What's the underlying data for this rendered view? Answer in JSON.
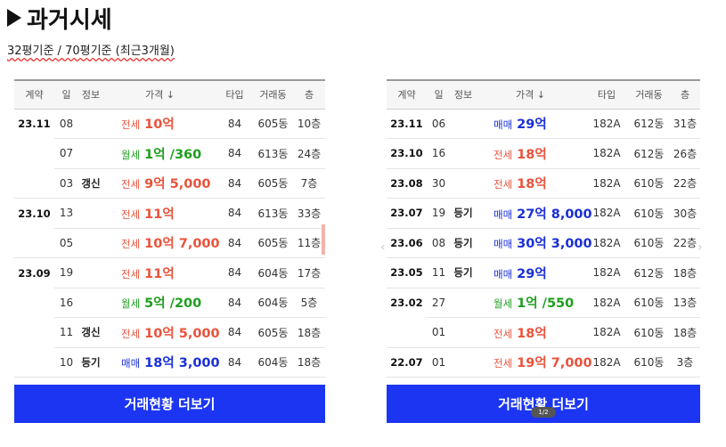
{
  "title": "과거시세",
  "subtitle": "32평기준 / 70평기준 (최근3개월)",
  "headers": [
    "계약",
    "일",
    "정보",
    "가격 ↓",
    "타입",
    "거래동",
    "층"
  ],
  "colors": {
    "jeonse": "#e8533c",
    "wolse": "#1e9e1e",
    "maemae": "#1a2fd6",
    "button": "#1b35f2"
  },
  "left": {
    "rows": [
      {
        "contract": "23.11",
        "day": "08",
        "info": "",
        "kind": "전세",
        "amount": "10억",
        "type": "84",
        "dong": "605동",
        "floor": "10층"
      },
      {
        "contract": "",
        "day": "07",
        "info": "",
        "kind": "월세",
        "amount": "1억 /360",
        "type": "84",
        "dong": "613동",
        "floor": "24층"
      },
      {
        "contract": "",
        "day": "03",
        "info": "갱신",
        "kind": "전세",
        "amount": "9억 5,000",
        "type": "84",
        "dong": "605동",
        "floor": "7층"
      },
      {
        "contract": "23.10",
        "day": "13",
        "info": "",
        "kind": "전세",
        "amount": "11억",
        "type": "84",
        "dong": "613동",
        "floor": "33층"
      },
      {
        "contract": "",
        "day": "05",
        "info": "",
        "kind": "전세",
        "amount": "10억 7,000",
        "type": "84",
        "dong": "605동",
        "floor": "11층"
      },
      {
        "contract": "23.09",
        "day": "19",
        "info": "",
        "kind": "전세",
        "amount": "11억",
        "type": "84",
        "dong": "604동",
        "floor": "17층"
      },
      {
        "contract": "",
        "day": "16",
        "info": "",
        "kind": "월세",
        "amount": "5억 /200",
        "type": "84",
        "dong": "604동",
        "floor": "5층"
      },
      {
        "contract": "",
        "day": "11",
        "info": "갱신",
        "kind": "전세",
        "amount": "10억 5,000",
        "type": "84",
        "dong": "605동",
        "floor": "18층"
      },
      {
        "contract": "",
        "day": "10",
        "info": "등기",
        "kind": "매매",
        "amount": "18억 3,000",
        "type": "84",
        "dong": "604동",
        "floor": "18층"
      }
    ],
    "button": "거래현황 더보기"
  },
  "right": {
    "rows": [
      {
        "contract": "23.11",
        "day": "06",
        "info": "",
        "kind": "매매",
        "amount": "29억",
        "type": "182A",
        "dong": "612동",
        "floor": "31층"
      },
      {
        "contract": "23.10",
        "day": "16",
        "info": "",
        "kind": "전세",
        "amount": "18억",
        "type": "182A",
        "dong": "612동",
        "floor": "26층"
      },
      {
        "contract": "23.08",
        "day": "30",
        "info": "",
        "kind": "전세",
        "amount": "18억",
        "type": "182A",
        "dong": "610동",
        "floor": "22층"
      },
      {
        "contract": "23.07",
        "day": "19",
        "info": "등기",
        "kind": "매매",
        "amount": "27억 8,000",
        "type": "182A",
        "dong": "610동",
        "floor": "30층"
      },
      {
        "contract": "23.06",
        "day": "08",
        "info": "등기",
        "kind": "매매",
        "amount": "30억 3,000",
        "type": "182A",
        "dong": "610동",
        "floor": "22층"
      },
      {
        "contract": "23.05",
        "day": "11",
        "info": "등기",
        "kind": "매매",
        "amount": "29억",
        "type": "182A",
        "dong": "612동",
        "floor": "18층"
      },
      {
        "contract": "23.02",
        "day": "27",
        "info": "",
        "kind": "월세",
        "amount": "1억 /550",
        "type": "182A",
        "dong": "610동",
        "floor": "13층"
      },
      {
        "contract": "",
        "day": "01",
        "info": "",
        "kind": "전세",
        "amount": "18억",
        "type": "182A",
        "dong": "610동",
        "floor": "18층"
      },
      {
        "contract": "22.07",
        "day": "01",
        "info": "",
        "kind": "전세",
        "amount": "19억 7,000",
        "type": "182A",
        "dong": "610동",
        "floor": "3층"
      }
    ],
    "button": "거래현황 더보기"
  },
  "page_indicator": "1/2"
}
